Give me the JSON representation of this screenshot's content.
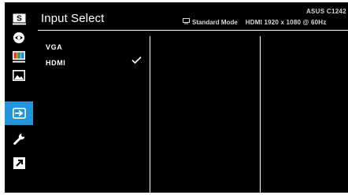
{
  "sidebar": {
    "items": [
      {
        "icon": "splendid-icon",
        "glyph": "S"
      },
      {
        "icon": "eye-care-icon"
      },
      {
        "icon": "color-icon"
      },
      {
        "icon": "image-icon"
      },
      {
        "icon": "input-select-icon",
        "active": true
      },
      {
        "icon": "system-setup-icon"
      },
      {
        "icon": "shortcut-icon"
      }
    ],
    "active_color": "#2196dd"
  },
  "header": {
    "title": "Input Select",
    "model": "ASUS C1242",
    "mode": "Standard Mode",
    "resolution": "HDMI 1920 x 1080 @ 60Hz"
  },
  "menu": {
    "items": [
      {
        "label": "VGA",
        "selected": false
      },
      {
        "label": "HDMI",
        "selected": true
      }
    ]
  }
}
